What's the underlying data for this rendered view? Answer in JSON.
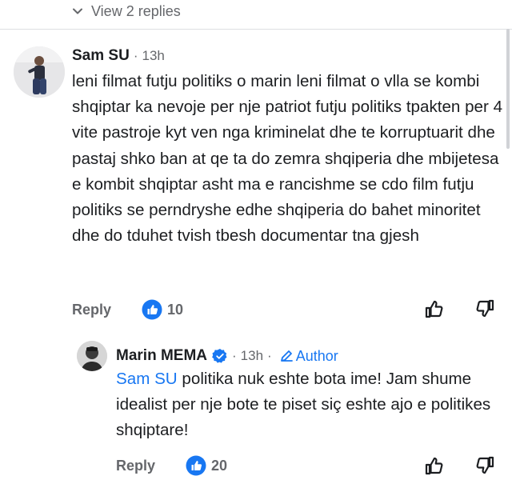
{
  "view_replies": {
    "label": "View 2 replies",
    "icon": "chevron-down-icon"
  },
  "comments": [
    {
      "author": "Sam SU",
      "separator": "·",
      "time": "13h",
      "text": "leni filmat futju politiks o marin leni filmat o vlla se kombi shqiptar ka nevoje per nje patriot futju politiks tpakten per 4 vite pastroje kyt ven nga kriminelat dhe te korruptuarit dhe pastaj shko ban at qe ta do zemra shqiperia dhe mbijetesa e kombit shqiptar asht ma e rancishme se cdo film futju politiks se perndryshe edhe shqiperia do bahet minoritet dhe do tduhet tvish tbesh documentar tna gjesh",
      "reply_label": "Reply",
      "likes": "10"
    },
    {
      "author": "Marin MEMA",
      "verified": true,
      "separator": "·",
      "time": "13h",
      "author_badge": "Author",
      "mention": "Sam SU",
      "text": " politika nuk eshte bota ime! Jam shume idealist per nje bote te piset siç eshte ajo e politikes shqiptare!",
      "reply_label": "Reply",
      "likes": "20"
    }
  ],
  "colors": {
    "accent": "#1877f2",
    "secondary_text": "#65676b",
    "primary_text": "#1c1e21"
  }
}
